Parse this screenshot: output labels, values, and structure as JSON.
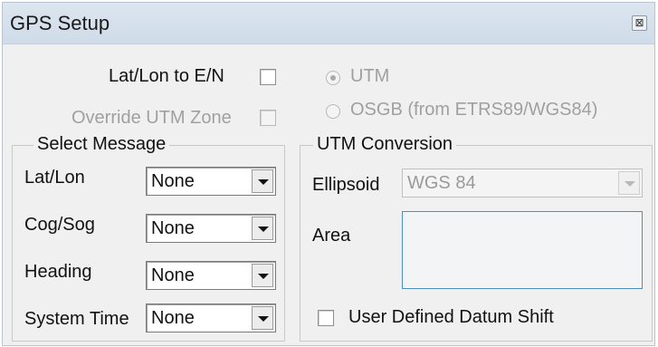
{
  "window": {
    "title": "GPS Setup",
    "close_glyph": "⊠"
  },
  "options": {
    "latlon_to_en_label": "Lat/Lon to E/N",
    "override_utm_label": "Override UTM Zone",
    "utm_label": "UTM",
    "osgb_label": "OSGB (from ETRS89/WGS84)"
  },
  "select_message": {
    "title": "Select Message",
    "rows": [
      {
        "label": "Lat/Lon",
        "value": "None"
      },
      {
        "label": "Cog/Sog",
        "value": "None"
      },
      {
        "label": "Heading",
        "value": "None"
      },
      {
        "label": "System Time",
        "value": "None"
      }
    ]
  },
  "utm_conversion": {
    "title": "UTM Conversion",
    "ellipsoid_label": "Ellipsoid",
    "ellipsoid_value": "WGS 84",
    "area_label": "Area",
    "area_value": "",
    "datum_shift_label": "User Defined Datum Shift"
  },
  "colors": {
    "focus_border": "#4f8fc0",
    "disabled_text": "#a0a0a0"
  }
}
